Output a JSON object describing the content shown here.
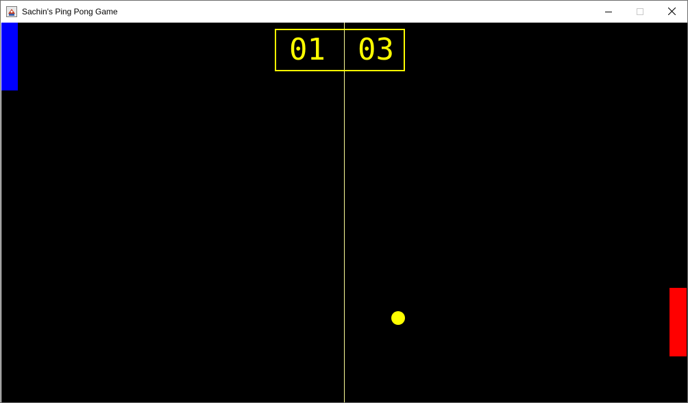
{
  "window": {
    "title": "Sachin's Ping Pong Game",
    "icon": "java-app-icon",
    "controls": [
      "minimize-icon",
      "maximize-icon",
      "close-icon"
    ]
  },
  "game": {
    "background_color": "#000000",
    "center_line_color": "#ffff99",
    "scoreboard": {
      "player1_score": "01",
      "player2_score": "03",
      "color": "#ffff00"
    },
    "paddles": {
      "player1_color": "#0000ff",
      "player2_color": "#ff0000"
    },
    "ball_color": "#ffff00"
  }
}
